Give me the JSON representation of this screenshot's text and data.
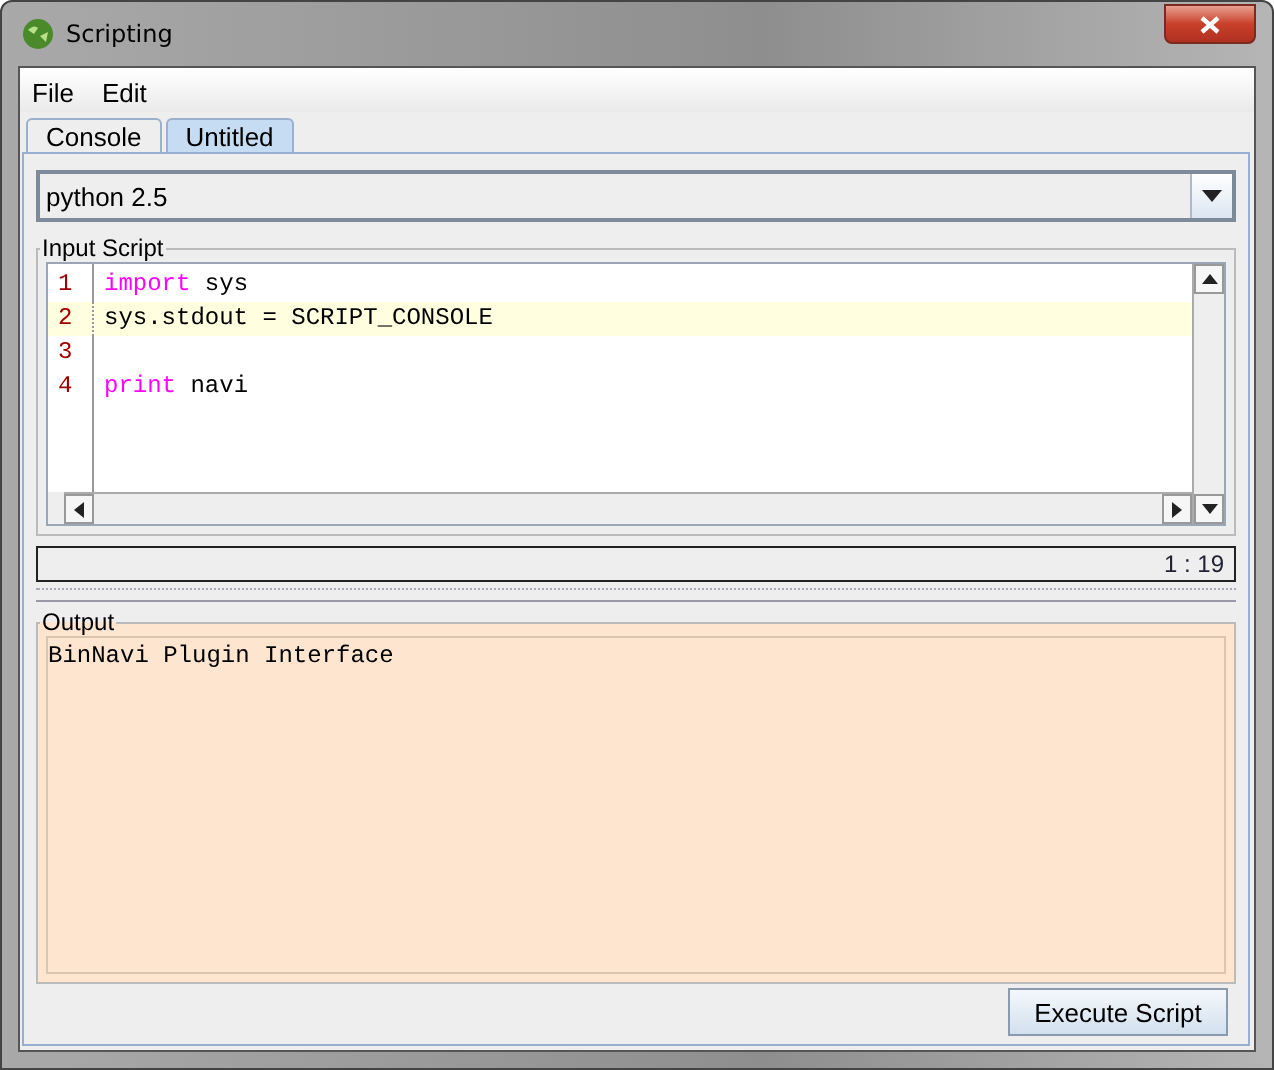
{
  "window": {
    "title": "Scripting"
  },
  "menu": [
    "File",
    "Edit"
  ],
  "tabs": [
    {
      "label": "Console",
      "selected": false
    },
    {
      "label": "Untitled",
      "selected": true
    }
  ],
  "language": {
    "value": "python 2.5"
  },
  "input_script": {
    "title": "Input Script",
    "lines": [
      {
        "number": "1",
        "current": false,
        "tokens": [
          {
            "text": "import",
            "kind": "keyword"
          },
          {
            "text": " sys",
            "kind": "plain"
          }
        ]
      },
      {
        "number": "2",
        "current": true,
        "tokens": [
          {
            "text": "sys.stdout = SCRIPT_CONSOLE",
            "kind": "plain"
          }
        ]
      },
      {
        "number": "3",
        "current": false
      },
      {
        "number": "4",
        "current": false,
        "tokens": [
          {
            "text": "print",
            "kind": "keyword"
          },
          {
            "text": " navi",
            "kind": "plain"
          }
        ]
      }
    ]
  },
  "caret_position": "1 : 19",
  "output": {
    "title": "Output",
    "text": "BinNavi Plugin Interface"
  },
  "buttons": [
    "Execute Script"
  ]
}
